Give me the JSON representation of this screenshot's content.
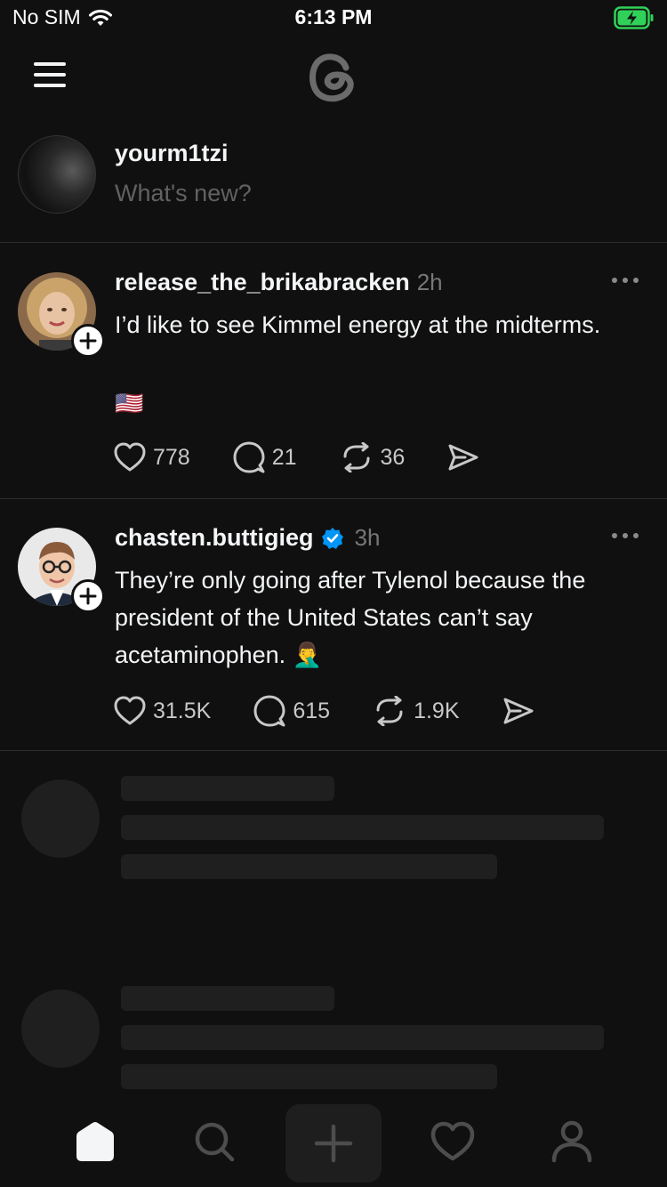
{
  "status_bar": {
    "carrier": "No SIM",
    "time": "6:13 PM",
    "battery_color": "#30d158"
  },
  "header": {
    "menu_icon": "hamburger-icon",
    "logo_icon": "threads-logo-icon"
  },
  "composer": {
    "username": "yourm1tzi",
    "placeholder": "What's new?"
  },
  "posts": [
    {
      "author": "release_the_brikabracken",
      "time": "2h",
      "verified": false,
      "text": "I’d like to see Kimmel energy at the midterms.",
      "emoji": "🇺🇸",
      "likes": "778",
      "replies": "21",
      "reposts": "36"
    },
    {
      "author": "chasten.buttigieg",
      "time": "3h",
      "verified": true,
      "text": "They’re only going after Tylenol because the president of the United States can’t say acetaminophen.",
      "emoji": "🤦‍♂️",
      "likes": "31.5K",
      "replies": "615",
      "reposts": "1.9K"
    }
  ],
  "tab_bar": {
    "items": [
      "home-icon",
      "search-icon",
      "create-icon",
      "activity-heart-icon",
      "profile-icon"
    ],
    "active": "home-icon"
  },
  "colors": {
    "background": "#101010",
    "text_primary": "#f3f5f7",
    "text_secondary": "#777777",
    "verified_badge": "#0095f6",
    "skeleton": "#1f1f1f"
  }
}
